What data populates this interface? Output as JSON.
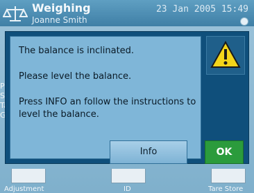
{
  "header": {
    "title": "Weighing",
    "user": "Joanne Smith",
    "date_time": "23 Jan 2005  15:49"
  },
  "background": {
    "side_labels": [
      "Pr",
      "Sa",
      "Ta",
      "Gr"
    ]
  },
  "softkeys": [
    {
      "label": "Adjustment"
    },
    {
      "label": "ID"
    },
    {
      "label": "Tare Store"
    }
  ],
  "dialog": {
    "line1": "The balance is inclinated.",
    "line2": "Please level the balance.",
    "line3": "Press INFO an follow the instructions to level the balance.",
    "info_label": "Info",
    "ok_label": "OK",
    "warning_icon": "warning-triangle",
    "colors": {
      "dialog_bg": "#0f4f7b",
      "ok_green": "#2b9b3c",
      "warn_yellow": "#f3d51b"
    }
  }
}
